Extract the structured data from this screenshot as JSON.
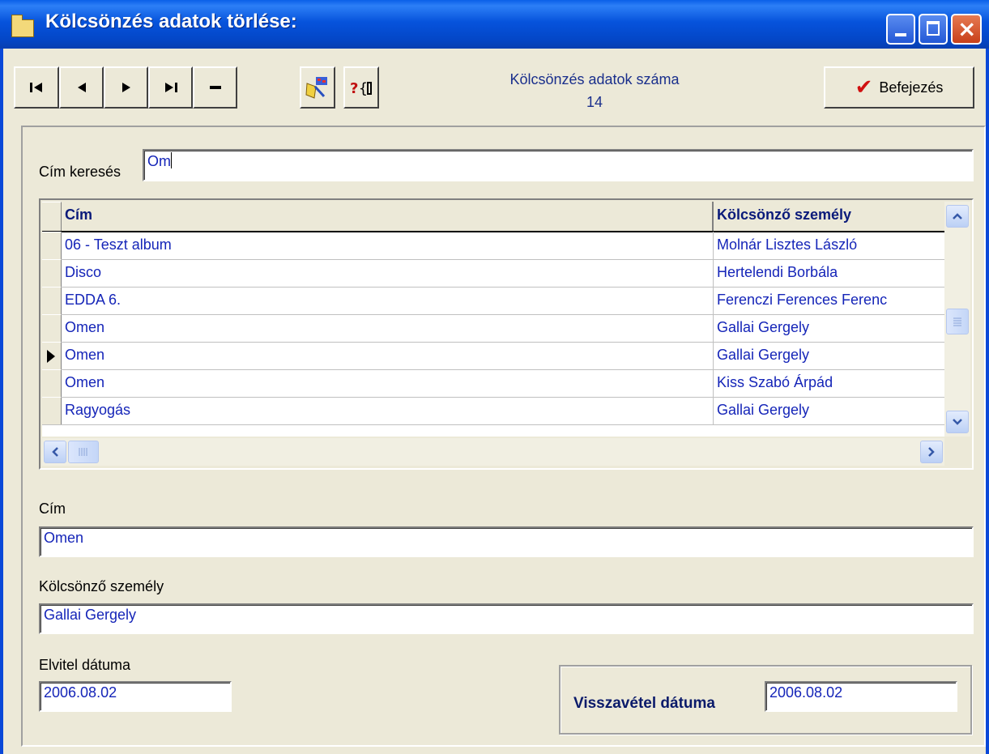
{
  "window": {
    "title": "Kölcsönzés adatok törlése:",
    "controls": {
      "minimize": "_",
      "maximize": "□",
      "close": "×"
    }
  },
  "toolbar": {
    "nav_buttons": [
      {
        "name": "first-record-icon",
        "glyph": "|◀"
      },
      {
        "name": "prior-record-icon",
        "glyph": "◀"
      },
      {
        "name": "next-record-icon",
        "glyph": "▶"
      },
      {
        "name": "last-record-icon",
        "glyph": "▶|"
      },
      {
        "name": "delete-record-icon",
        "glyph": "—"
      }
    ],
    "count_label": "Kölcsönzés adatok száma",
    "count_value": "14",
    "finish_label": "Befejezés"
  },
  "search": {
    "label": "Cím keresés",
    "value": "Om"
  },
  "grid": {
    "columns": [
      "Cím",
      "Kölcsönző személy"
    ],
    "rows": [
      {
        "title": "06 - Teszt album",
        "person": "Molnár Lisztes László",
        "current": false
      },
      {
        "title": "Disco",
        "person": "Hertelendi Borbála",
        "current": false
      },
      {
        "title": "EDDA 6.",
        "person": "Ferenczi Ferences Ferenc",
        "current": false
      },
      {
        "title": "Omen",
        "person": "Gallai Gergely",
        "current": false
      },
      {
        "title": "Omen",
        "person": "Gallai Gergely",
        "current": true
      },
      {
        "title": "Omen",
        "person": "Kiss Szabó Árpád",
        "current": false
      },
      {
        "title": "Ragyogás",
        "person": "Gallai Gergely",
        "current": false
      }
    ]
  },
  "details": {
    "title_label": "Cím",
    "title_value": "Omen",
    "person_label": "Kölcsönző személy",
    "person_value": "Gallai Gergely",
    "takeout_label": "Elvitel dátuma",
    "takeout_value": "2006.08.02",
    "return_label": "Visszavétel dátuma",
    "return_value": "2006.08.02"
  },
  "colors": {
    "titlebar": "#0a48d8",
    "field_text": "#1525b8",
    "face": "#ece9d8"
  }
}
